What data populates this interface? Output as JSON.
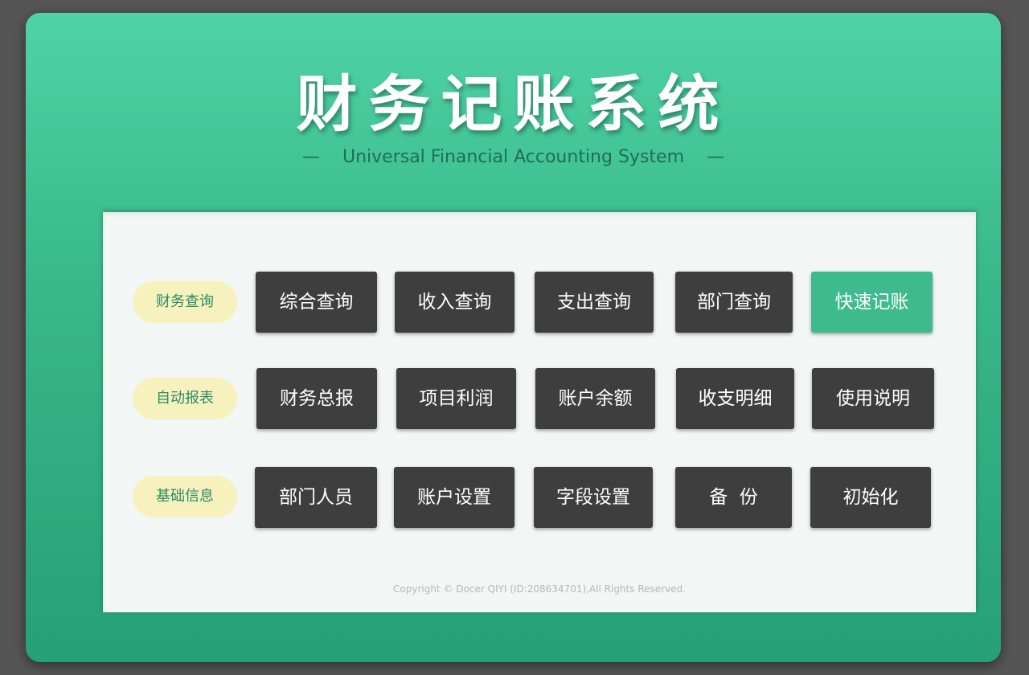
{
  "header": {
    "title": "财务记账系统",
    "subtitle": "Universal Financial Accounting System",
    "dash": "—"
  },
  "rows": [
    {
      "label": "财务查询",
      "buttons": [
        "综合查询",
        "收入查询",
        "支出查询",
        "部门查询",
        "快速记账"
      ]
    },
    {
      "label": "自动报表",
      "buttons": [
        "财务总报",
        "项目利润",
        "账户余额",
        "收支明细",
        "使用说明"
      ]
    },
    {
      "label": "基础信息",
      "buttons": [
        "部门人员",
        "账户设置",
        "字段设置",
        "备  份",
        "初始化"
      ]
    }
  ],
  "footer": {
    "copyright": "Copyright © Docer QIYI (ID:208634701),All Rights Reserved."
  },
  "colors": {
    "frame_top": "#4fd3a6",
    "frame_bottom": "#26a077",
    "button": "#3e3e3e",
    "accent_button": "#3dbb8d",
    "label_pill": "#f7f2bd",
    "label_text": "#2a8a67",
    "panel": "#f2f6f4"
  }
}
